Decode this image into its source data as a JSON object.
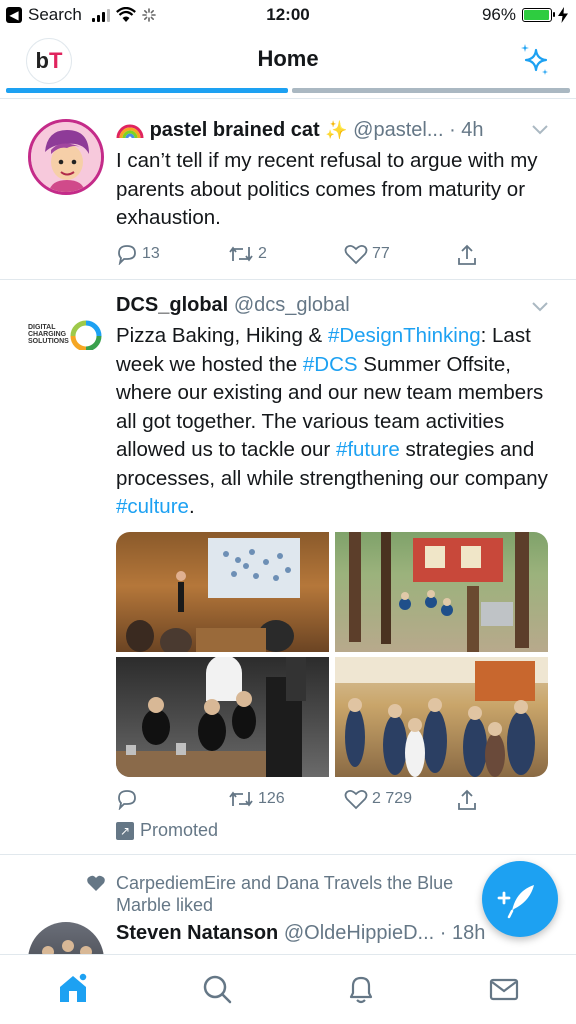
{
  "status_bar": {
    "back_label": "Search",
    "time": "12:00",
    "battery": "96%",
    "battery_level": 0.96
  },
  "header": {
    "logo_b": "b",
    "logo_t": "T",
    "title": "Home"
  },
  "tweets": [
    {
      "name": "pastel brained cat",
      "handle": "@pastel...",
      "time": "· 4h",
      "text": "I can’t tell if my recent refusal to argue with my parents about politics comes from maturity or exhaustion.",
      "replies": "13",
      "retweets": "2",
      "likes": "77"
    },
    {
      "name": "DCS_global",
      "handle": "@dcs_global",
      "logo_lines": [
        "DIGITAL",
        "CHARGING",
        "SOLUTIONS"
      ],
      "text_parts": [
        "Pizza Baking, Hiking & ",
        "#DesignThinking",
        ": Last week we hosted the ",
        "#DCS",
        " Summer Offsite, where our existing and our new team members all got together. The various team activities allowed us to tackle our ",
        "#future",
        " strategies and processes, all while strengthening our company ",
        "#culture",
        "."
      ],
      "retweets": "126",
      "likes": "2 729",
      "promoted": "Promoted"
    },
    {
      "liked_by": "CarpediemEire and Dana Travels the Blue Marble liked",
      "name": "Steven Natanson",
      "handle": "@OldeHippieD...",
      "time": "· 18h"
    }
  ],
  "colors": {
    "accent": "#1da1f2",
    "text": "#14171a",
    "muted": "#657786"
  },
  "nav": [
    "home-icon",
    "search-icon",
    "notifications-icon",
    "messages-icon"
  ]
}
